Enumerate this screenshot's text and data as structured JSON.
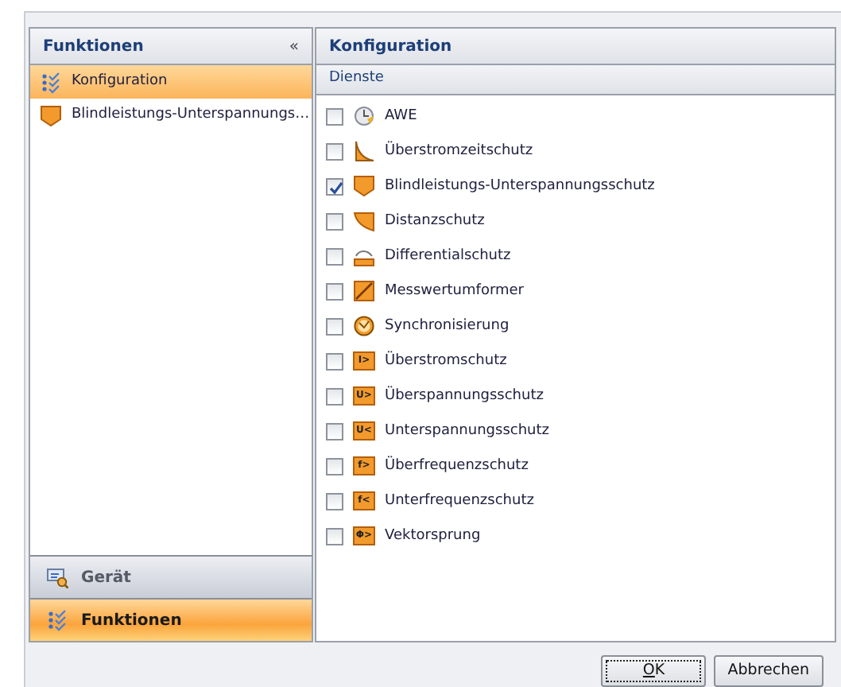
{
  "left_panel": {
    "title": "Funktionen",
    "collapse": "«",
    "items": [
      {
        "label": "Konfiguration",
        "kind": "checklist",
        "selected": true
      },
      {
        "label": "Blindleistungs-Unterspannungs…",
        "kind": "shield",
        "selected": false
      }
    ],
    "sections": [
      {
        "label": "Gerät",
        "kind": "device",
        "selected": false
      },
      {
        "label": "Funktionen",
        "kind": "checklist",
        "selected": true
      }
    ]
  },
  "right_panel": {
    "title": "Konfiguration",
    "subtitle": "Dienste",
    "services": [
      {
        "label": "AWE",
        "kind": "clock",
        "checked": false
      },
      {
        "label": "Überstromzeitschutz",
        "kind": "curve",
        "checked": false
      },
      {
        "label": "Blindleistungs-Unterspannungsschutz",
        "kind": "shield",
        "checked": true
      },
      {
        "label": "Distanzschutz",
        "kind": "wedge",
        "checked": false
      },
      {
        "label": "Differentialschutz",
        "kind": "diff",
        "checked": false
      },
      {
        "label": "Messwertumformer",
        "kind": "transducer",
        "checked": false
      },
      {
        "label": "Synchronisierung",
        "kind": "sync",
        "checked": false
      },
      {
        "label": "Überstromschutz",
        "kind": "box",
        "symbol": "I>",
        "checked": false
      },
      {
        "label": "Überspannungsschutz",
        "kind": "box",
        "symbol": "U>",
        "checked": false
      },
      {
        "label": "Unterspannungsschutz",
        "kind": "box",
        "symbol": "U<",
        "checked": false
      },
      {
        "label": "Überfrequenzschutz",
        "kind": "box",
        "symbol": "f>",
        "checked": false
      },
      {
        "label": "Unterfrequenzschutz",
        "kind": "box",
        "symbol": "f<",
        "checked": false
      },
      {
        "label": "Vektorsprung",
        "kind": "box",
        "symbol": "Φ>",
        "checked": false
      }
    ]
  },
  "buttons": [
    {
      "label": "OK",
      "default": true
    },
    {
      "label": "Abbrechen",
      "default": false
    }
  ]
}
